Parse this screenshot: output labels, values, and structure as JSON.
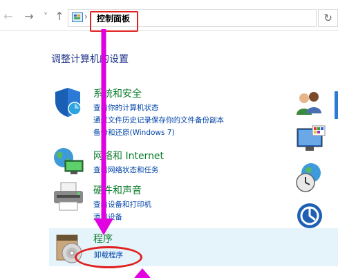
{
  "toolbar": {
    "back": "←",
    "forward": "→",
    "recent": "˅",
    "up": "↑",
    "refresh": "↻",
    "breadcrumb_separator": "›",
    "address": "控制面板"
  },
  "main": {
    "heading": "调整计算机的设置",
    "categories": [
      {
        "title": "系统和安全",
        "icon": "shield-icon",
        "links": [
          "查看你的计算机状态",
          "通过文件历史记录保存你的文件备份副本",
          "备份和还原(Windows 7)"
        ]
      },
      {
        "title": "网络和 Internet",
        "icon": "network-globe-icon",
        "links": [
          "查看网络状态和任务"
        ]
      },
      {
        "title": "硬件和声音",
        "icon": "printer-icon",
        "links": [
          "查看设备和打印机",
          "添加设备"
        ]
      },
      {
        "title": "程序",
        "icon": "programs-disc-icon",
        "links": [
          "卸载程序"
        ]
      }
    ],
    "right_icons": [
      "user-accounts-icon",
      "appearance-icon",
      "clock-region-icon",
      "ease-of-access-icon"
    ]
  },
  "annotation": {
    "color": "#e000e0",
    "highlight_color": "#e0201f"
  }
}
